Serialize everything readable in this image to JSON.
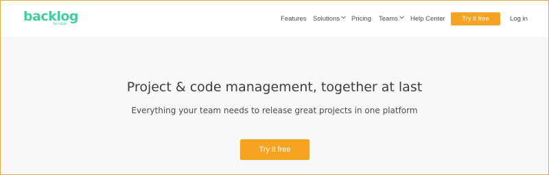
{
  "brand": {
    "name": "backlog",
    "byline": "by nulab",
    "color": "#42ce9f"
  },
  "nav": {
    "items": [
      {
        "label": "Features",
        "dropdown": false
      },
      {
        "label": "Solutions",
        "dropdown": true
      },
      {
        "label": "Pricing",
        "dropdown": false
      },
      {
        "label": "Teams",
        "dropdown": true
      },
      {
        "label": "Help Center",
        "dropdown": false
      }
    ],
    "cta_label": "Try it free",
    "login_label": "Log in"
  },
  "hero": {
    "title": "Project & code management, together at last",
    "subtitle": "Everything your team needs to release great projects in one platform",
    "cta_label": "Try it free"
  },
  "colors": {
    "accent": "#f5a321",
    "frame_border": "#e8a838",
    "background": "#f8f8fb"
  }
}
